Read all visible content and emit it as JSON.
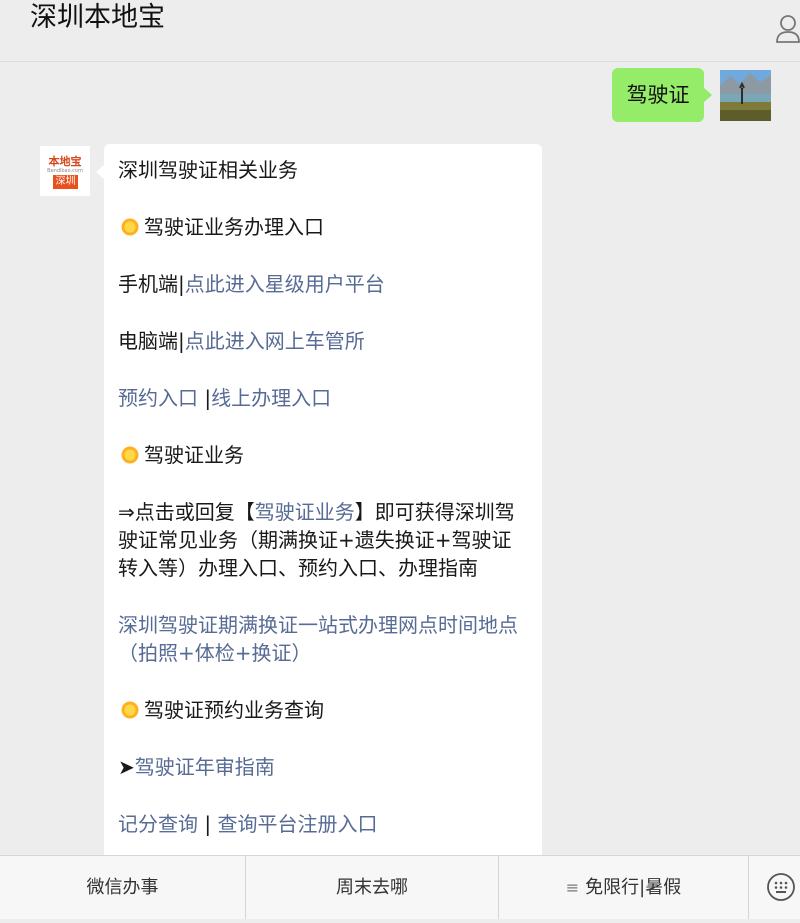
{
  "header": {
    "title": "深圳本地宝",
    "profile_icon": "person-icon"
  },
  "user_message": {
    "text": "驾驶证"
  },
  "bot_avatar": {
    "brand": "本地宝",
    "url": "Bendibao.com",
    "city": "深圳"
  },
  "bot_message": {
    "heading": "深圳驾驶证相关业务",
    "section1": "驾驶证业务办理入口",
    "mobile_prefix": "手机端|",
    "mobile_link": "点此进入星级用户平台",
    "pc_prefix": "电脑端|",
    "pc_link": "点此进入网上车管所",
    "appt_link": "预约入口",
    "appt_sep": " |",
    "online_link": "线上办理入口",
    "section2": "驾驶证业务",
    "reply_prefix": "⇒点击或回复【",
    "reply_link": "驾驶证业务",
    "reply_suffix": "】即可获得深圳驾驶证常见业务（期满换证+遗失换证+驾驶证转入等）办理入口、预约入口、办理指南",
    "station_link": "深圳驾驶证期满换证一站式办理网点时间地点（拍照+体检+换证）",
    "section3": "驾驶证预约业务查询",
    "arrow": "➤",
    "annual_link": "驾驶证年审指南",
    "points_link": "记分查询",
    "points_sep": " | ",
    "register_link": "查询平台注册入口"
  },
  "menu": {
    "items": [
      {
        "label": "微信办事"
      },
      {
        "label": "周末去哪"
      },
      {
        "label": "免限行|暑假",
        "icon": "≡"
      }
    ],
    "keyboard_icon": "keyboard-icon"
  },
  "colors": {
    "link": "#576b95",
    "user_bubble": "#95ec69",
    "background": "#ededed"
  }
}
